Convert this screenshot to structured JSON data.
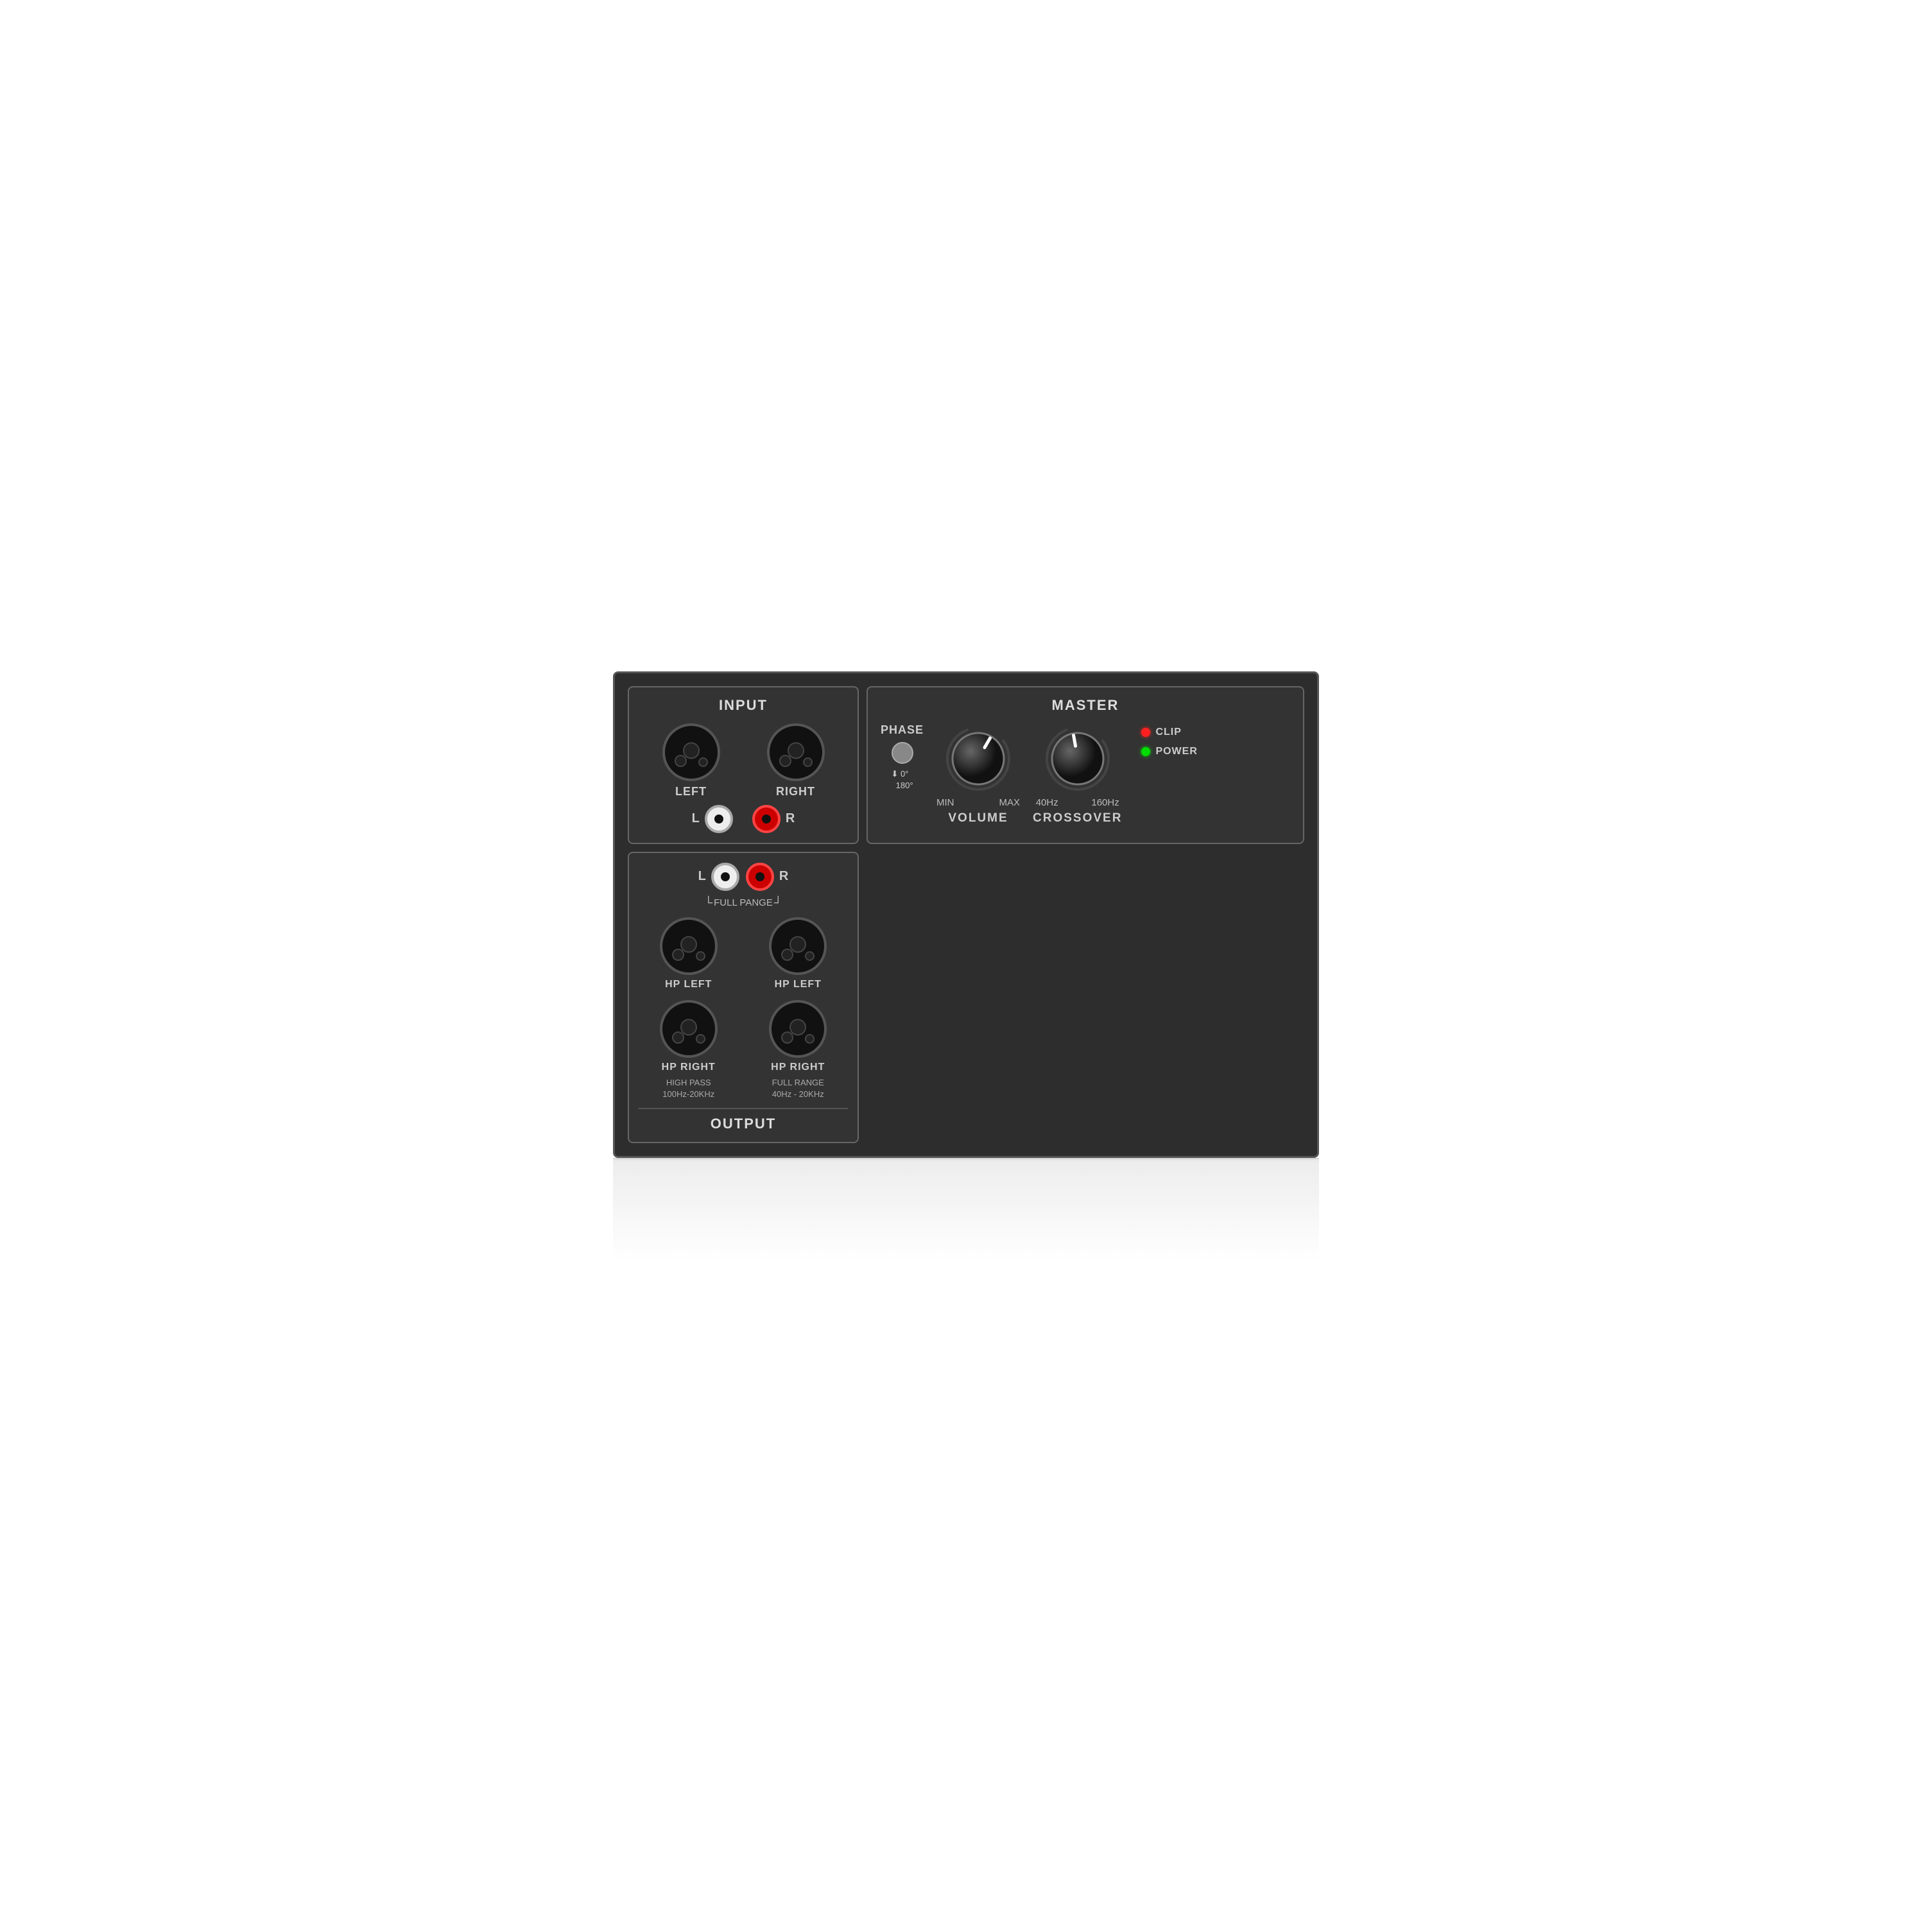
{
  "device": {
    "input": {
      "title": "INPUT",
      "left_label": "LEFT",
      "right_label": "RIGHT",
      "rca_left": "L",
      "rca_right": "R"
    },
    "master": {
      "title": "MASTER",
      "phase_label": "PHASE",
      "phase_0": "0°",
      "phase_180": "180°",
      "volume_label": "VOLUME",
      "volume_min": "MIN",
      "volume_max": "MAX",
      "crossover_label": "CROSSOVER",
      "crossover_low": "40Hz",
      "crossover_high": "160Hz",
      "clip_label": "CLIP",
      "power_label": "POWER"
    },
    "output": {
      "title": "OUTPUT",
      "rca_left": "L",
      "rca_right": "R",
      "full_pange": "FULL PANGE",
      "hp_left_1": "HP LEFT",
      "hp_left_2": "HP LEFT",
      "hp_right_1": "HP RIGHT",
      "hp_right_2": "HP RIGHT",
      "high_pass_info": "HIGH PASS\n100Hz-20KHz",
      "full_range_info": "FULL RANGE\n40Hz - 20KHz"
    }
  }
}
